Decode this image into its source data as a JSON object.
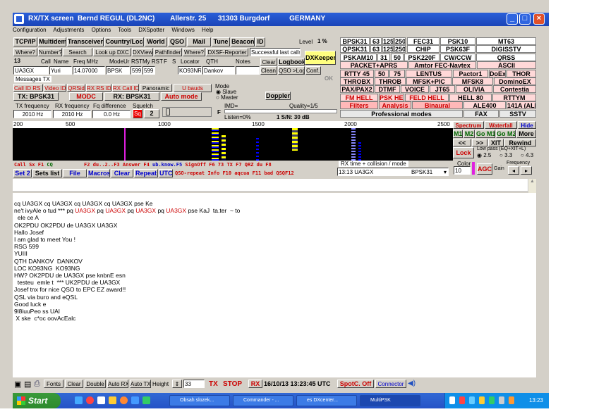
{
  "window": {
    "title": "RX/TX screen  Bernd REGUL (DL2NC)        Allerstr. 25      31303 Burgdorf          GERMANY"
  },
  "menu": [
    "Configuration",
    "Adjustments",
    "Options",
    "Tools",
    "DXSpotter",
    "Windows",
    "Help"
  ],
  "qso_tabs": [
    "TCP/IP",
    "Multidem",
    "Transceiver",
    "Country/Loc",
    "World",
    "QSO",
    "Mail",
    "Tune",
    "Beacon",
    "ID"
  ],
  "level": {
    "label": "Level",
    "value": "1 %"
  },
  "qso_fields": {
    "headers": [
      "Where?",
      "Number?",
      "Search",
      "Look up DXC",
      "DXView",
      "Pathfinder",
      "Where?",
      "DXSF-Reporter",
      "Successful last callsign"
    ],
    "row2": [
      "13",
      "Call",
      "Name",
      "Freq MHz",
      "ModeUr",
      "RST",
      "My RST",
      "F",
      "S",
      "Locator",
      "QTH",
      "Notes",
      "Clear",
      "Logbook",
      "DXKeeper"
    ],
    "call": "UA3GX",
    "name": "Yuri",
    "freq": "14.07000",
    "mode": "BPSK",
    "rst": "599",
    "my_rst": "599",
    "locator": "KO93NR",
    "qth": "Dankov",
    "row3_buttons": [
      "Clean Li",
      "QSO >Log",
      "Conf. F"
    ],
    "messages": "Messages TX",
    "ok": "OK"
  },
  "tx_row": [
    "Call ID RS ID",
    "Video ID",
    "QRSid",
    "RX RS ID",
    "RX Call ID",
    "Panoramic",
    "U bauds",
    "Mode",
    "Slave",
    "Master",
    "Doppler"
  ],
  "tx_mode": "TX: BPSK31",
  "modc": "MODC",
  "rx_mode": "RX: BPSK31",
  "auto_mode": "Auto mode",
  "freq_labels": [
    "TX frequency",
    "RX frequency",
    "Fq difference",
    "Squelch"
  ],
  "freq_values": [
    "2010 Hz",
    "2010 Hz",
    "0.0 Hz",
    "Sq",
    "2"
  ],
  "imd": {
    "label": "IMD=",
    "quality": "Quality=1/5",
    "listen": "Listen=0%",
    "sn": "1  S/N: 30 dB",
    "f": "F"
  },
  "modes": [
    [
      "BPSK31",
      "63",
      "125",
      "250",
      "FEC31",
      "PSK10",
      "MT63"
    ],
    [
      "QPSK31",
      "63",
      "125",
      "250",
      "CHIP",
      "PSK63F",
      "DIGISSTV"
    ],
    [
      "PSKAM10",
      "31",
      "50",
      "PSK220F",
      "CW/CCW",
      "QRSS"
    ],
    [
      "PACKET+APRS",
      "Amtor FEC-Navtex",
      "ASCII"
    ],
    [
      "RTTY 45",
      "50",
      "75",
      "LENTUS",
      "Pactor1",
      "DoEx",
      "THOR"
    ],
    [
      "THROBX",
      "THROB",
      "MFSK+PIC",
      "MFSK8",
      "DominoEX"
    ],
    [
      "PAX/PAX2",
      "DTMF",
      "VOICE",
      "JT65",
      "OLIVIA",
      "Contestia"
    ],
    [
      "FM HELL",
      "PSK HELL",
      "FELD HELL",
      "HELL 80",
      "RTTYM"
    ],
    [
      "Filters",
      "Analysis",
      "Binaural",
      "ALE400",
      "141A (ALE)"
    ],
    [
      "Professional modes",
      "FAX",
      "SSTV"
    ]
  ],
  "scale": [
    "200",
    "500",
    "1000",
    "1500",
    "2000",
    "2500"
  ],
  "right_panel": {
    "tabs": [
      "Spectrum",
      "Waterfall",
      "Hide"
    ],
    "mem": [
      "M1",
      "M2",
      "Go M1",
      "Go M2",
      "More"
    ],
    "nav": [
      "<<",
      ">>",
      "XIT",
      "Rewind"
    ],
    "lock": "Lock",
    "lowpass": "Low pass (EQ+XIT+L)",
    "radios": [
      "2.5",
      "3.3",
      "4.3"
    ],
    "color_label": "Color",
    "color_val": "10",
    "agc": "AGC",
    "gain": "Gain",
    "freq_label": "Frequency"
  },
  "macros_row1": [
    "Call",
    "Sx",
    "F1",
    "CQ",
    "F2",
    "du..2..F3",
    "Answer",
    "F4",
    "ub.know.F5",
    "SignOff",
    "F6",
    "73",
    "TX",
    "F7",
    "QRZ du",
    "F8"
  ],
  "macros_row2": [
    "Set 2",
    "Sets list",
    "File",
    "Macros",
    "Clear",
    "Repeat",
    "UTC",
    "QSO-repeat",
    "Info",
    "F10",
    "aqcua",
    "F11",
    "bad",
    "QSQF12"
  ],
  "rx_time": {
    "label": "RX time + collision / mode",
    "value": "13:13  UA3GX",
    "mode": "BPSK31"
  },
  "rx_lines": [
    "cq UA3GX cq UA3GX cq UA3GX cq UA3GX pse Ke",
    "ne't ivyAle o tud *** pq UA3GX pq UA3GX pq UA3GX pq UA3GX pse KaJ  ta.ter  ~ to",
    "  ele ce A",
    "",
    "OK2PDU OK2PDU de UA3GX UA3GX",
    "Hallo Josef",
    "I am glad to meet You !",
    "RSG 599",
    "YUIII",
    "QTH DANKOV  DANKOV",
    "LOC KO93NG  KO93NG",
    "HW? OK2PDU de UA3GX pse knbnE esn",
    "  testeu  emle t  *** UK2PDU de UA3GX",
    "Josef tnx for nice QSO to EPC EZ award!!",
    "QSL via buro and eQSL",
    "Good luck e",
    "9l8iuuPeo ss UAl",
    " X ske  c*oc oovAcEalc"
  ],
  "status": [
    "Fonts",
    "Clear",
    "Double",
    "Auto RX",
    "Auto TX",
    "Height",
    "33",
    "TX",
    "STOP",
    "RX",
    "16/10/13 13:23:45 UTC",
    "SpotC. Off",
    "Connector"
  ],
  "taskbar": {
    "start": "Start",
    "tasks": [
      "Obsah slozek...",
      "Commander - ...",
      "es DXcenter...",
      "MultiPSK"
    ],
    "clock": "13:23"
  }
}
